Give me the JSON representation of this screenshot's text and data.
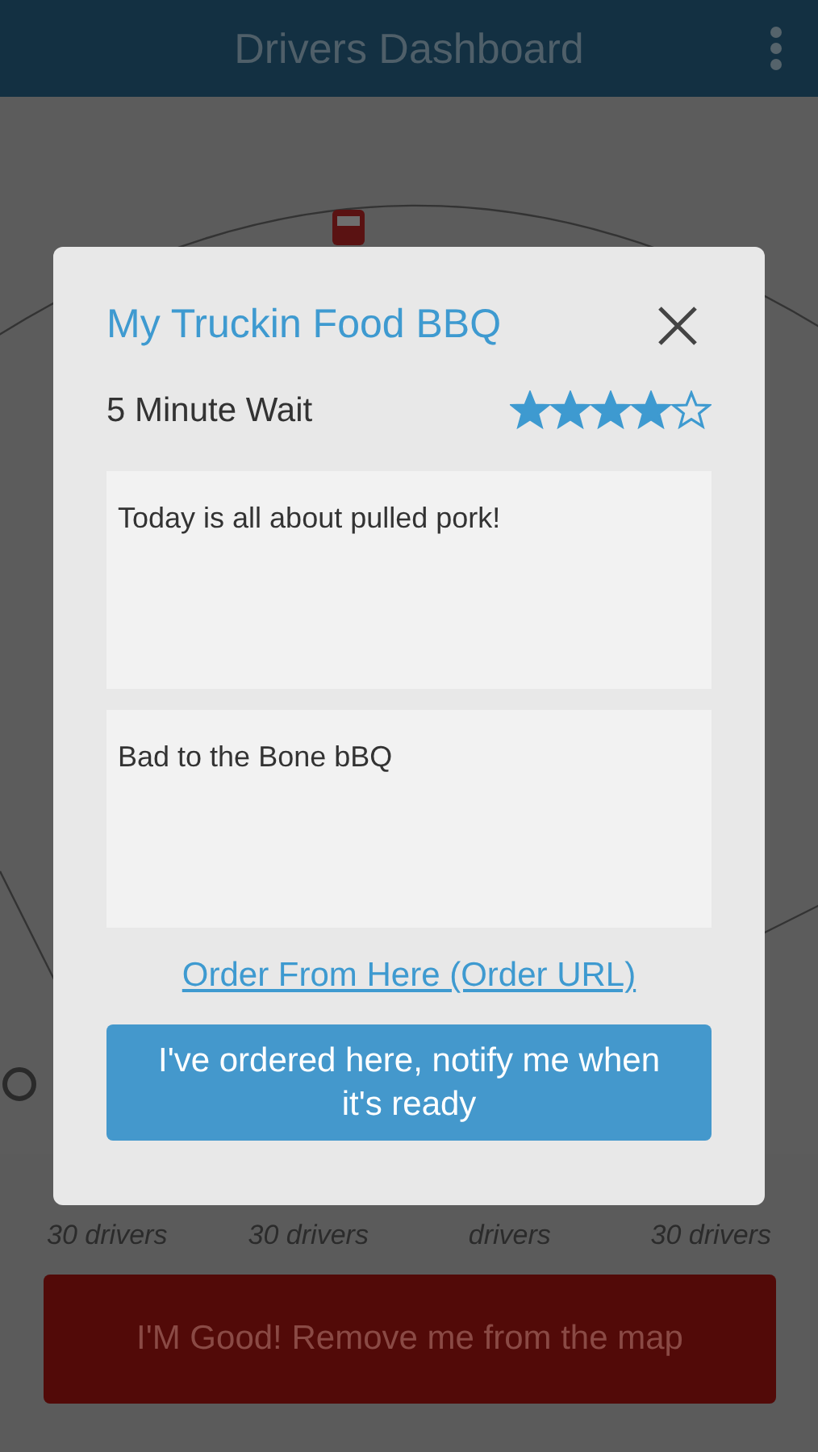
{
  "header": {
    "title": "Drivers Dashboard"
  },
  "legend": [
    {
      "text": "30 drivers"
    },
    {
      "text": "30 drivers"
    },
    {
      "text": "drivers"
    },
    {
      "text": "30 drivers"
    }
  ],
  "remove_button": "I'M Good! Remove me from the map",
  "dialog": {
    "title": "My Truckin Food BBQ",
    "wait": "5 Minute Wait",
    "stars": 4,
    "notes": [
      "Today is all about pulled pork!",
      "Bad to the Bone bBQ"
    ],
    "link": "Order From Here (Order URL)",
    "notify_button": "I've ordered here, notify me when it's ready"
  }
}
